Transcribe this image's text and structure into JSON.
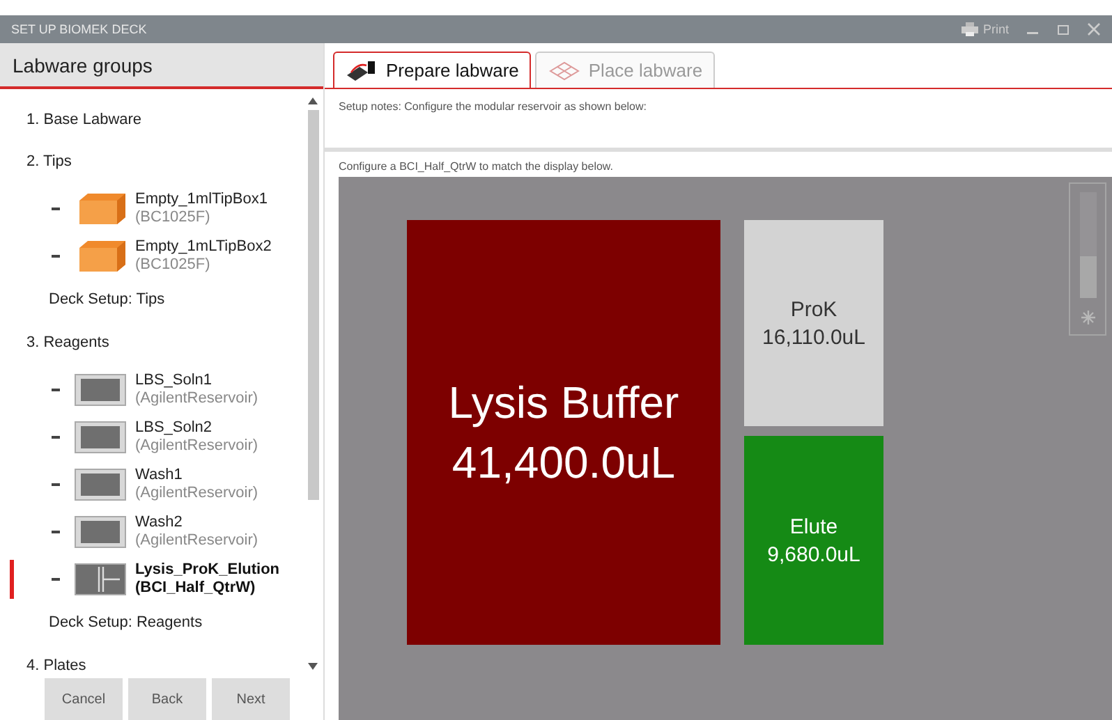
{
  "window": {
    "title": "SET UP BIOMEK DECK",
    "print_label": "Print"
  },
  "sidebar": {
    "title": "Labware groups",
    "groups": [
      {
        "label": "1. Base Labware"
      },
      {
        "label": "2. Tips",
        "items": [
          {
            "kind": "tipbox",
            "name": "Empty_1mlTipBox1",
            "type": "(BC1025F)",
            "selected": false
          },
          {
            "kind": "tipbox",
            "name": "Empty_1mLTipBox2",
            "type": "(BC1025F)",
            "selected": false
          }
        ],
        "deck_setup": "Deck Setup: Tips"
      },
      {
        "label": "3. Reagents",
        "items": [
          {
            "kind": "reservoir",
            "name": "LBS_Soln1",
            "type": "(AgilentReservoir)",
            "selected": false
          },
          {
            "kind": "reservoir",
            "name": "LBS_Soln2",
            "type": "(AgilentReservoir)",
            "selected": false
          },
          {
            "kind": "reservoir",
            "name": "Wash1",
            "type": "(AgilentReservoir)",
            "selected": false
          },
          {
            "kind": "reservoir",
            "name": "Wash2",
            "type": "(AgilentReservoir)",
            "selected": false
          },
          {
            "kind": "quarter",
            "name": "Lysis_ProK_Elution",
            "type": "(BCI_Half_QtrW)",
            "selected": true
          }
        ],
        "deck_setup": "Deck Setup: Reagents"
      },
      {
        "label": "4. Plates"
      }
    ],
    "buttons": [
      "Cancel",
      "Back",
      "Next"
    ]
  },
  "tabs": [
    {
      "label": "Prepare labware",
      "selected": true
    },
    {
      "label": "Place labware",
      "selected": false
    }
  ],
  "setup_notes": "Setup notes:  Configure the modular reservoir as shown below:",
  "instruction": "Configure a BCI_Half_QtrW to match the display below.",
  "wells": [
    {
      "label": "Lysis Buffer",
      "volume": "41,400.0uL",
      "color": "#7d0000",
      "kind": "large"
    },
    {
      "label": "ProK",
      "volume": "16,110.0uL",
      "color": "#d3d3d3",
      "kind": "small"
    },
    {
      "label": "Elute",
      "volume": "9,680.0uL",
      "color": "#158a15",
      "kind": "small"
    }
  ],
  "zoom": {
    "level": 0.4
  }
}
